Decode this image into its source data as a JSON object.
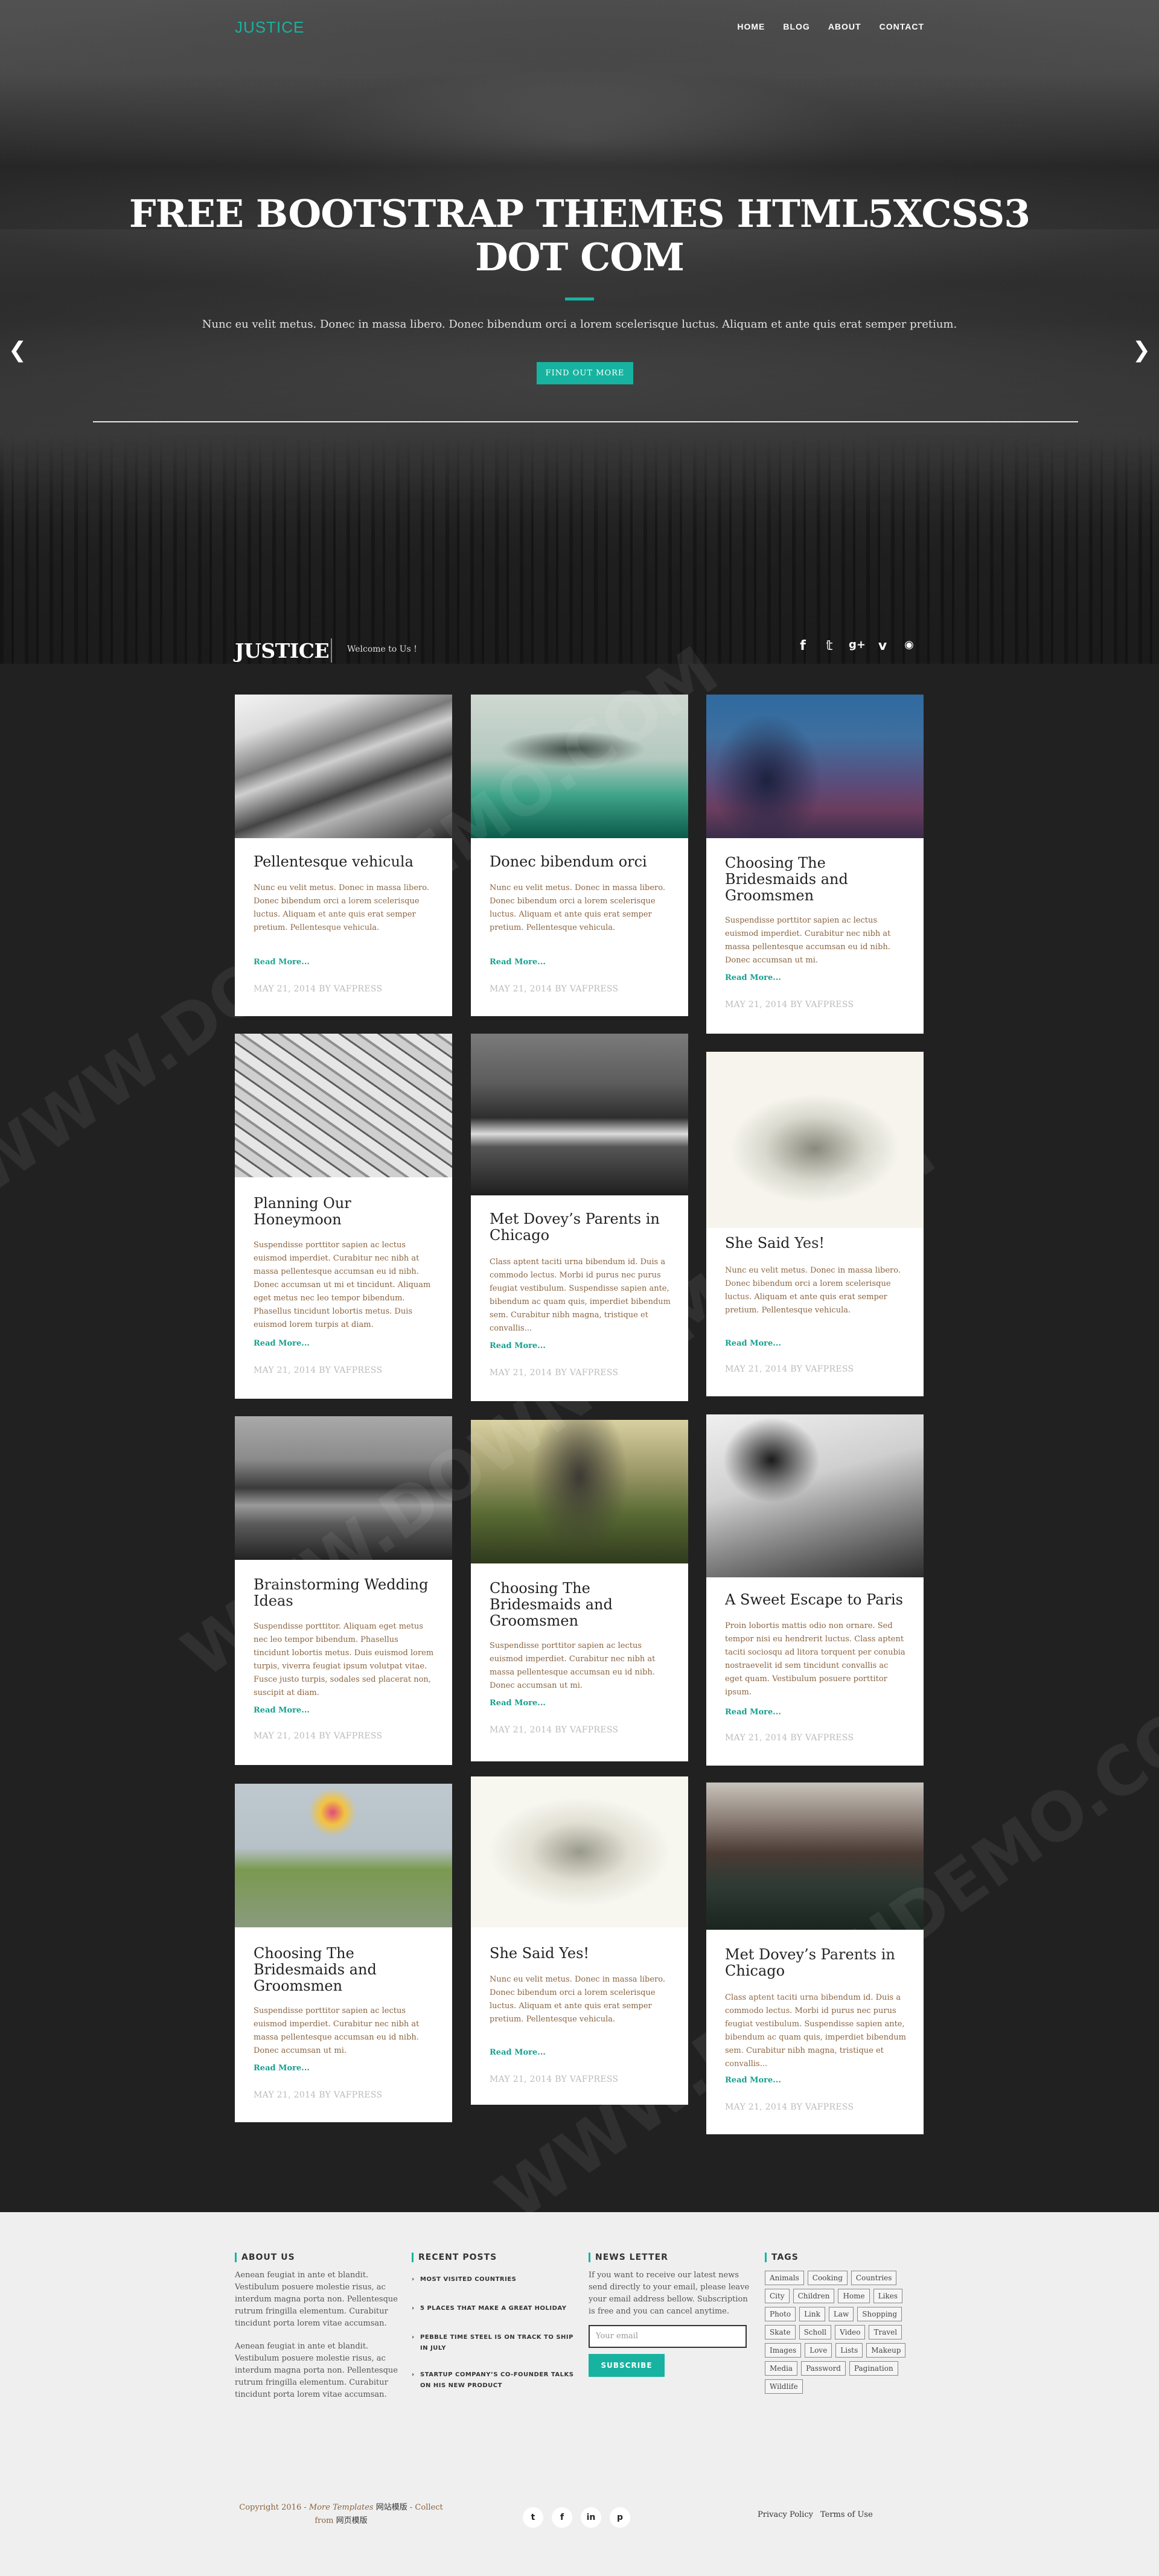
{
  "header": {
    "logo": "JUSTICE",
    "nav": [
      "HOME",
      "BLOG",
      "ABOUT",
      "CONTACT"
    ]
  },
  "hero": {
    "title": "FREE BOOTSTRAP THEMES HTML5XCSS3 DOT COM",
    "subtitle": "Nunc eu velit metus. Donec in massa libero. Donec bibendum orci a lorem scelerisque luctus. Aliquam et ante quis erat semper pretium.",
    "button": "FIND OUT MORE",
    "accent": "#17b3a0"
  },
  "blog_header": {
    "brand": "JUSTICE",
    "welcome": "Welcome to Us !",
    "social_icons": [
      "facebook-icon",
      "twitter-icon",
      "google-plus-icon",
      "vimeo-icon",
      "rss-icon"
    ]
  },
  "posts": [
    {
      "title": "Pellentesque vehicula",
      "excerpt": "Nunc eu velit metus. Donec in massa libero. Donec bibendum orci a lorem scelerisque luctus. Aliquam et ante quis erat semper pretium. Pellentesque vehicula.",
      "more": "Read More...",
      "meta": "MAY 21, 2014 BY VAFPRESS"
    },
    {
      "title": "Donec bibendum orci",
      "excerpt": "Nunc eu velit metus. Donec in massa libero. Donec bibendum orci a lorem scelerisque luctus. Aliquam et ante quis erat semper pretium. Pellentesque vehicula.",
      "more": "Read More...",
      "meta": "MAY 21, 2014 BY VAFPRESS"
    },
    {
      "title": "Choosing The Bridesmaids and Groomsmen",
      "excerpt": "Suspendisse porttitor sapien ac lectus euismod imperdiet. Curabitur nec nibh at massa pellentesque accumsan eu id nibh. Donec accumsan ut mi.",
      "more": "Read More...",
      "meta": "MAY 21, 2014 BY VAFPRESS"
    },
    {
      "title": "Planning Our Honeymoon",
      "excerpt": "Suspendisse porttitor sapien ac lectus euismod imperdiet. Curabitur nec nibh at massa pellentesque accumsan eu id nibh. Donec accumsan ut mi et tincidunt. Aliquam eget metus nec leo tempor bibendum. Phasellus tincidunt lobortis metus. Duis euismod lorem turpis at diam.",
      "more": "Read More...",
      "meta": "MAY 21, 2014 BY VAFPRESS"
    },
    {
      "title": "Met Dovey’s Parents in Chicago",
      "excerpt": "Class aptent taciti urna bibendum id. Duis a commodo lectus. Morbi id purus nec purus feugiat vestibulum. Suspendisse sapien ante, bibendum ac quam quis, imperdiet bibendum sem. Curabitur nibh magna, tristique et convallis...",
      "more": "Read More...",
      "meta": "MAY 21, 2014 BY VAFPRESS"
    },
    {
      "title": "She Said Yes!",
      "excerpt": "Nunc eu velit metus. Donec in massa libero. Donec bibendum orci a lorem scelerisque luctus. Aliquam et ante quis erat semper pretium. Pellentesque vehicula.",
      "more": "Read More...",
      "meta": "MAY 21, 2014 BY VAFPRESS"
    },
    {
      "title": "Brainstorming Wedding Ideas",
      "excerpt": "Suspendisse porttitor. Aliquam eget metus nec leo tempor bibendum. Phasellus tincidunt lobortis metus. Duis euismod lorem turpis, viverra feugiat ipsum volutpat vitae. Fusce justo turpis, sodales sed placerat non, suscipit at diam.",
      "more": "Read More...",
      "meta": "MAY 21, 2014 BY VAFPRESS"
    },
    {
      "title": "Choosing The Bridesmaids and Groomsmen",
      "excerpt": "Suspendisse porttitor sapien ac lectus euismod imperdiet. Curabitur nec nibh at massa pellentesque accumsan eu id nibh. Donec accumsan ut mi.",
      "more": "Read More...",
      "meta": "MAY 21, 2014 BY VAFPRESS"
    },
    {
      "title": "A Sweet Escape to Paris",
      "excerpt": "Proin lobortis mattis odio non ornare. Sed tempor nisi eu hendrerit luctus. Class aptent taciti sociosqu ad litora torquent per conubia nostraevelit id sem tincidunt convallis ac eget quam. Vestibulum posuere porttitor ipsum.",
      "more": "Read More...",
      "meta": "MAY 21, 2014 BY VAFPRESS"
    },
    {
      "title": "Choosing The Bridesmaids and Groomsmen",
      "excerpt": "Suspendisse porttitor sapien ac lectus euismod imperdiet. Curabitur nec nibh at massa pellentesque accumsan eu id nibh. Donec accumsan ut mi.",
      "more": "Read More...",
      "meta": "MAY 21, 2014 BY VAFPRESS"
    },
    {
      "title": "She Said Yes!",
      "excerpt": "Nunc eu velit metus. Donec in massa libero. Donec bibendum orci a lorem scelerisque luctus. Aliquam et ante quis erat semper pretium. Pellentesque vehicula.",
      "more": "Read More...",
      "meta": "MAY 21, 2014 BY VAFPRESS"
    },
    {
      "title": "Met Dovey’s Parents in Chicago",
      "excerpt": "Class aptent taciti urna bibendum id. Duis a commodo lectus. Morbi id purus nec purus feugiat vestibulum. Suspendisse sapien ante, bibendum ac quam quis, imperdiet bibendum sem. Curabitur nibh magna, tristique et convallis...",
      "more": "Read More...",
      "meta": "MAY 21, 2014 BY VAFPRESS"
    }
  ],
  "footer": {
    "about": {
      "heading": "ABOUT US",
      "p1": "Aenean feugiat in ante et blandit. Vestibulum posuere molestie risus, ac interdum magna porta non. Pellentesque rutrum fringilla elementum. Curabitur tincidunt porta lorem vitae accumsan.",
      "p2": "Aenean feugiat in ante et blandit. Vestibulum posuere molestie risus, ac interdum magna porta non. Pellentesque rutrum fringilla elementum. Curabitur tincidunt porta lorem vitae accumsan."
    },
    "recent": {
      "heading": "RECENT POSTS",
      "items": [
        "MOST VISITED COUNTRIES",
        "5 PLACES THAT MAKE A GREAT HOLIDAY",
        "PEBBLE TIME STEEL IS ON TRACK TO SHIP IN JULY",
        "STARTUP COMPANY’S CO-FOUNDER TALKS ON HIS NEW PRODUCT"
      ]
    },
    "newsletter": {
      "heading": "NEWS LETTER",
      "text": "If you want to receive our latest news send directly to your email, please leave your email address bellow. Subscription is free and you can cancel anytime.",
      "placeholder": "Your email",
      "button": "SUBSCRIBE"
    },
    "tags": {
      "heading": "TAGS",
      "items": [
        "Animals",
        "Cooking",
        "Countries",
        "City",
        "Children",
        "Home",
        "Likes",
        "Photo",
        "Link",
        "Law",
        "Shopping",
        "Skate",
        "Scholl",
        "Video",
        "Travel",
        "Images",
        "Love",
        "Lists",
        "Makeup",
        "Media",
        "Password",
        "Pagination",
        "Wildlife"
      ]
    },
    "copyright_a": "Copyright 2016 -",
    "copyright_b": "More Templates",
    "copyright_c": "网站模版",
    "copyright_d": "- Collect from",
    "copyright_e": "网页模版",
    "social_icons": [
      "twitter-icon",
      "facebook-icon",
      "linkedin-icon",
      "pinterest-icon"
    ],
    "links": [
      "Privacy Policy",
      "Terms of Use"
    ]
  },
  "watermark": "WWW.DOWNDEMO.COM"
}
